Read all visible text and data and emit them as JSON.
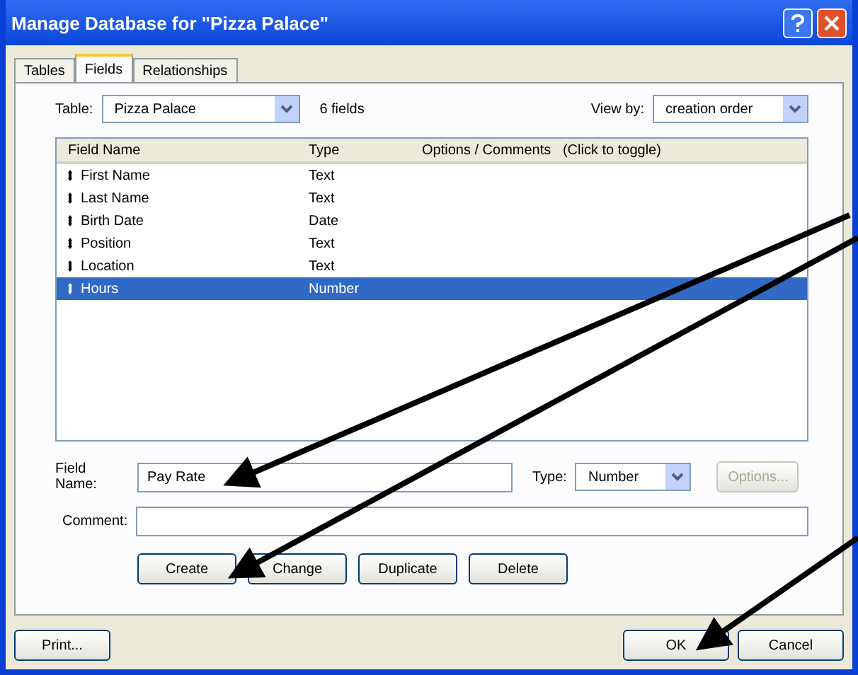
{
  "window": {
    "title": "Manage Database for \"Pizza Palace\""
  },
  "tabs": [
    {
      "label": "Tables",
      "selected": false
    },
    {
      "label": "Fields",
      "selected": true
    },
    {
      "label": "Relationships",
      "selected": false
    }
  ],
  "table_select": {
    "label": "Table:",
    "value": "Pizza Palace"
  },
  "field_count": "6 fields",
  "view_by": {
    "label": "View by:",
    "value": "creation order"
  },
  "columns": [
    "Field Name",
    "Type",
    "Options / Comments   (Click to toggle)"
  ],
  "rows": [
    {
      "name": "First Name",
      "type": "Text",
      "selected": false
    },
    {
      "name": "Last Name",
      "type": "Text",
      "selected": false
    },
    {
      "name": "Birth Date",
      "type": "Date",
      "selected": false
    },
    {
      "name": "Position",
      "type": "Text",
      "selected": false
    },
    {
      "name": "Location",
      "type": "Text",
      "selected": false
    },
    {
      "name": "Hours",
      "type": "Number",
      "selected": true
    }
  ],
  "field_name": {
    "label": "Field Name:",
    "value": "Pay Rate"
  },
  "type_select": {
    "label": "Type:",
    "value": "Number"
  },
  "options_button": {
    "label": "Options...",
    "disabled": true
  },
  "comment": {
    "label": "Comment:"
  },
  "actions": [
    "Create",
    "Change",
    "Duplicate",
    "Delete"
  ],
  "footer": {
    "print": "Print...",
    "ok": "OK",
    "cancel": "Cancel"
  }
}
